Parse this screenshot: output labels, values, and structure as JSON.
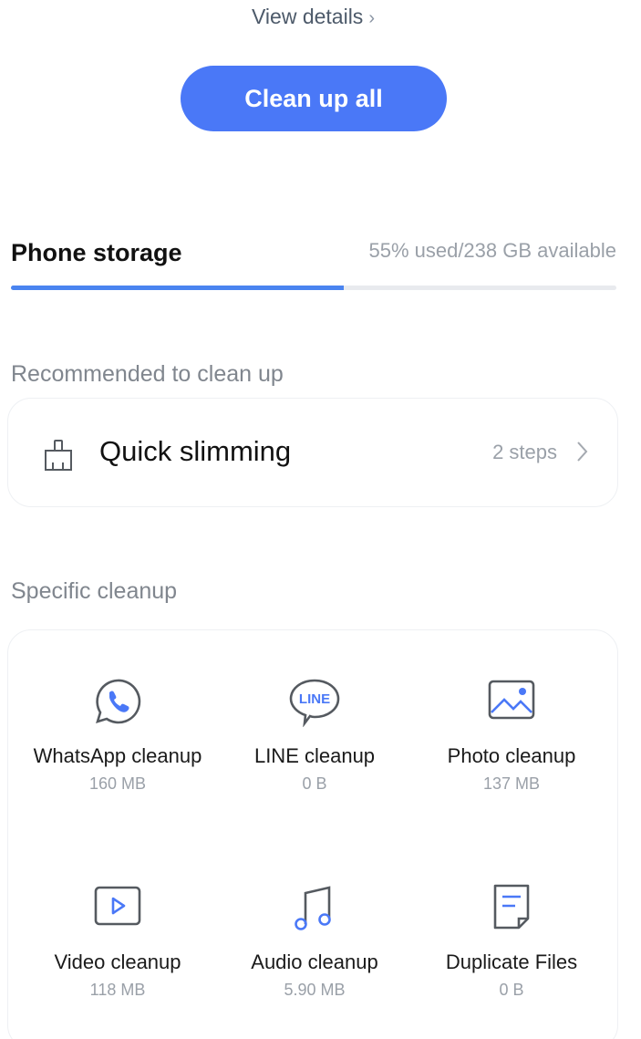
{
  "header": {
    "view_details": "View details",
    "cleanup_all": "Clean up all"
  },
  "storage": {
    "title": "Phone storage",
    "info": "55% used/238 GB available",
    "used_fraction": 0.55
  },
  "recommended": {
    "heading": "Recommended to clean up",
    "item": {
      "title": "Quick slimming",
      "steps": "2 steps",
      "icon": "broom-icon"
    }
  },
  "specific": {
    "heading": "Specific cleanup",
    "items": [
      {
        "label": "WhatsApp cleanup",
        "size": "160 MB",
        "icon": "whatsapp-icon"
      },
      {
        "label": "LINE cleanup",
        "size": "0 B",
        "icon": "line-icon"
      },
      {
        "label": "Photo cleanup",
        "size": "137 MB",
        "icon": "photo-icon"
      },
      {
        "label": "Video cleanup",
        "size": "118 MB",
        "icon": "video-icon"
      },
      {
        "label": "Audio cleanup",
        "size": "5.90 MB",
        "icon": "audio-icon"
      },
      {
        "label": "Duplicate Files",
        "size": "0 B",
        "icon": "duplicate-file-icon"
      }
    ]
  },
  "colors": {
    "accent": "#4a78f7",
    "icon_stroke": "#555a60"
  }
}
